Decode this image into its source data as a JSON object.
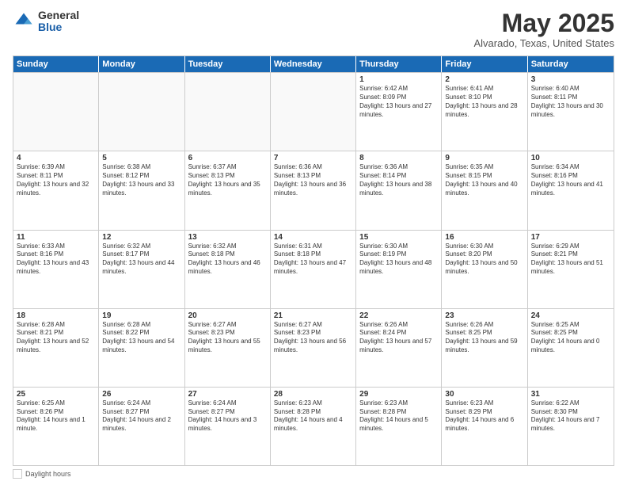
{
  "logo": {
    "general": "General",
    "blue": "Blue"
  },
  "title": "May 2025",
  "subtitle": "Alvarado, Texas, United States",
  "days_of_week": [
    "Sunday",
    "Monday",
    "Tuesday",
    "Wednesday",
    "Thursday",
    "Friday",
    "Saturday"
  ],
  "footer": {
    "daylight_label": "Daylight hours"
  },
  "weeks": [
    [
      {
        "day": "",
        "empty": true
      },
      {
        "day": "",
        "empty": true
      },
      {
        "day": "",
        "empty": true
      },
      {
        "day": "",
        "empty": true
      },
      {
        "day": "1",
        "sunrise": "Sunrise: 6:42 AM",
        "sunset": "Sunset: 8:09 PM",
        "daylight": "Daylight: 13 hours and 27 minutes."
      },
      {
        "day": "2",
        "sunrise": "Sunrise: 6:41 AM",
        "sunset": "Sunset: 8:10 PM",
        "daylight": "Daylight: 13 hours and 28 minutes."
      },
      {
        "day": "3",
        "sunrise": "Sunrise: 6:40 AM",
        "sunset": "Sunset: 8:11 PM",
        "daylight": "Daylight: 13 hours and 30 minutes."
      }
    ],
    [
      {
        "day": "4",
        "sunrise": "Sunrise: 6:39 AM",
        "sunset": "Sunset: 8:11 PM",
        "daylight": "Daylight: 13 hours and 32 minutes."
      },
      {
        "day": "5",
        "sunrise": "Sunrise: 6:38 AM",
        "sunset": "Sunset: 8:12 PM",
        "daylight": "Daylight: 13 hours and 33 minutes."
      },
      {
        "day": "6",
        "sunrise": "Sunrise: 6:37 AM",
        "sunset": "Sunset: 8:13 PM",
        "daylight": "Daylight: 13 hours and 35 minutes."
      },
      {
        "day": "7",
        "sunrise": "Sunrise: 6:36 AM",
        "sunset": "Sunset: 8:13 PM",
        "daylight": "Daylight: 13 hours and 36 minutes."
      },
      {
        "day": "8",
        "sunrise": "Sunrise: 6:36 AM",
        "sunset": "Sunset: 8:14 PM",
        "daylight": "Daylight: 13 hours and 38 minutes."
      },
      {
        "day": "9",
        "sunrise": "Sunrise: 6:35 AM",
        "sunset": "Sunset: 8:15 PM",
        "daylight": "Daylight: 13 hours and 40 minutes."
      },
      {
        "day": "10",
        "sunrise": "Sunrise: 6:34 AM",
        "sunset": "Sunset: 8:16 PM",
        "daylight": "Daylight: 13 hours and 41 minutes."
      }
    ],
    [
      {
        "day": "11",
        "sunrise": "Sunrise: 6:33 AM",
        "sunset": "Sunset: 8:16 PM",
        "daylight": "Daylight: 13 hours and 43 minutes."
      },
      {
        "day": "12",
        "sunrise": "Sunrise: 6:32 AM",
        "sunset": "Sunset: 8:17 PM",
        "daylight": "Daylight: 13 hours and 44 minutes."
      },
      {
        "day": "13",
        "sunrise": "Sunrise: 6:32 AM",
        "sunset": "Sunset: 8:18 PM",
        "daylight": "Daylight: 13 hours and 46 minutes."
      },
      {
        "day": "14",
        "sunrise": "Sunrise: 6:31 AM",
        "sunset": "Sunset: 8:18 PM",
        "daylight": "Daylight: 13 hours and 47 minutes."
      },
      {
        "day": "15",
        "sunrise": "Sunrise: 6:30 AM",
        "sunset": "Sunset: 8:19 PM",
        "daylight": "Daylight: 13 hours and 48 minutes."
      },
      {
        "day": "16",
        "sunrise": "Sunrise: 6:30 AM",
        "sunset": "Sunset: 8:20 PM",
        "daylight": "Daylight: 13 hours and 50 minutes."
      },
      {
        "day": "17",
        "sunrise": "Sunrise: 6:29 AM",
        "sunset": "Sunset: 8:21 PM",
        "daylight": "Daylight: 13 hours and 51 minutes."
      }
    ],
    [
      {
        "day": "18",
        "sunrise": "Sunrise: 6:28 AM",
        "sunset": "Sunset: 8:21 PM",
        "daylight": "Daylight: 13 hours and 52 minutes."
      },
      {
        "day": "19",
        "sunrise": "Sunrise: 6:28 AM",
        "sunset": "Sunset: 8:22 PM",
        "daylight": "Daylight: 13 hours and 54 minutes."
      },
      {
        "day": "20",
        "sunrise": "Sunrise: 6:27 AM",
        "sunset": "Sunset: 8:23 PM",
        "daylight": "Daylight: 13 hours and 55 minutes."
      },
      {
        "day": "21",
        "sunrise": "Sunrise: 6:27 AM",
        "sunset": "Sunset: 8:23 PM",
        "daylight": "Daylight: 13 hours and 56 minutes."
      },
      {
        "day": "22",
        "sunrise": "Sunrise: 6:26 AM",
        "sunset": "Sunset: 8:24 PM",
        "daylight": "Daylight: 13 hours and 57 minutes."
      },
      {
        "day": "23",
        "sunrise": "Sunrise: 6:26 AM",
        "sunset": "Sunset: 8:25 PM",
        "daylight": "Daylight: 13 hours and 59 minutes."
      },
      {
        "day": "24",
        "sunrise": "Sunrise: 6:25 AM",
        "sunset": "Sunset: 8:25 PM",
        "daylight": "Daylight: 14 hours and 0 minutes."
      }
    ],
    [
      {
        "day": "25",
        "sunrise": "Sunrise: 6:25 AM",
        "sunset": "Sunset: 8:26 PM",
        "daylight": "Daylight: 14 hours and 1 minute."
      },
      {
        "day": "26",
        "sunrise": "Sunrise: 6:24 AM",
        "sunset": "Sunset: 8:27 PM",
        "daylight": "Daylight: 14 hours and 2 minutes."
      },
      {
        "day": "27",
        "sunrise": "Sunrise: 6:24 AM",
        "sunset": "Sunset: 8:27 PM",
        "daylight": "Daylight: 14 hours and 3 minutes."
      },
      {
        "day": "28",
        "sunrise": "Sunrise: 6:23 AM",
        "sunset": "Sunset: 8:28 PM",
        "daylight": "Daylight: 14 hours and 4 minutes."
      },
      {
        "day": "29",
        "sunrise": "Sunrise: 6:23 AM",
        "sunset": "Sunset: 8:28 PM",
        "daylight": "Daylight: 14 hours and 5 minutes."
      },
      {
        "day": "30",
        "sunrise": "Sunrise: 6:23 AM",
        "sunset": "Sunset: 8:29 PM",
        "daylight": "Daylight: 14 hours and 6 minutes."
      },
      {
        "day": "31",
        "sunrise": "Sunrise: 6:22 AM",
        "sunset": "Sunset: 8:30 PM",
        "daylight": "Daylight: 14 hours and 7 minutes."
      }
    ]
  ]
}
